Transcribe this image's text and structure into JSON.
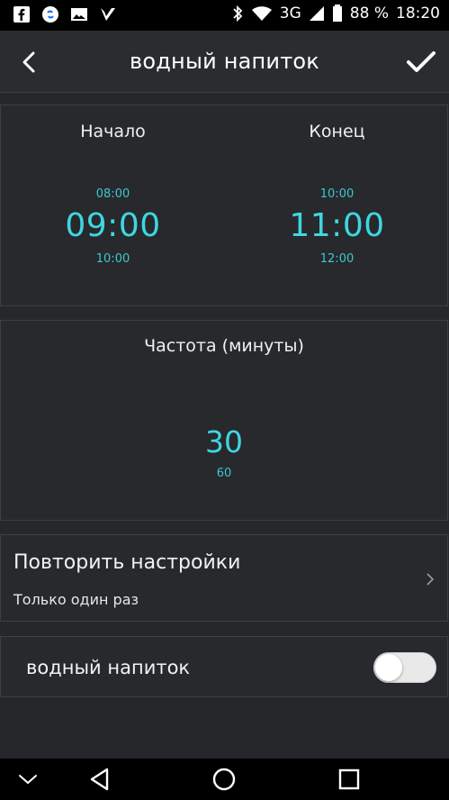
{
  "status_bar": {
    "network": "3G",
    "battery": "88 %",
    "time": "18:20",
    "icons": [
      "facebook-icon",
      "shazam-icon",
      "image-icon",
      "check-flag-icon",
      "bluetooth-icon",
      "wifi-icon",
      "signal-icon",
      "battery-icon"
    ]
  },
  "app_bar": {
    "title": "водный напиток",
    "back_icon": "chevron-left-icon",
    "confirm_icon": "check-icon"
  },
  "time_picker": {
    "start": {
      "label": "Начало",
      "prev": "08:00",
      "value": "09:00",
      "next": "10:00"
    },
    "end": {
      "label": "Конец",
      "prev": "10:00",
      "value": "11:00",
      "next": "12:00"
    }
  },
  "frequency": {
    "label": "Частота (минуты)",
    "value": "30",
    "next": "60"
  },
  "repeat": {
    "title": "Повторить настройки",
    "value": "Только один раз"
  },
  "toggle": {
    "label": "водный напиток",
    "on": false
  },
  "nav_bar": {
    "icons": [
      "chevron-down-icon",
      "back-triangle-icon",
      "home-circle-icon",
      "recents-square-icon"
    ]
  },
  "colors": {
    "accent": "#3fd6df",
    "background": "#25272b",
    "card": "#27292d"
  }
}
